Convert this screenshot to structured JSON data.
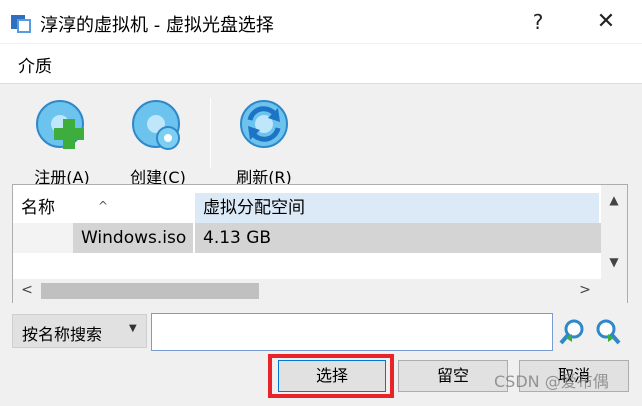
{
  "window": {
    "title": "淳淳的虚拟机 - 虚拟光盘选择",
    "help_label": "?",
    "close_label": "✕"
  },
  "menu": {
    "items": [
      "介质"
    ]
  },
  "toolbar": {
    "register_label": "注册(A)",
    "create_label": "创建(C)",
    "refresh_label": "刷新(R)",
    "register_icon": "disc-add-icon",
    "create_icon": "disc-create-icon",
    "refresh_icon": "refresh-icon"
  },
  "table": {
    "columns": [
      "名称",
      "虚拟分配空间"
    ],
    "rows": [
      {
        "name": "Windows.iso",
        "size": "4.13 GB"
      }
    ]
  },
  "search": {
    "mode": "按名称搜索",
    "value": ""
  },
  "buttons": {
    "select": "选择",
    "empty": "留空",
    "cancel": "取消"
  },
  "watermark": "CSDN @爱布偶",
  "colors": {
    "highlight": "#e8232a",
    "header_selected": "#dceaf7",
    "row_selected": "#d4d4d4"
  }
}
